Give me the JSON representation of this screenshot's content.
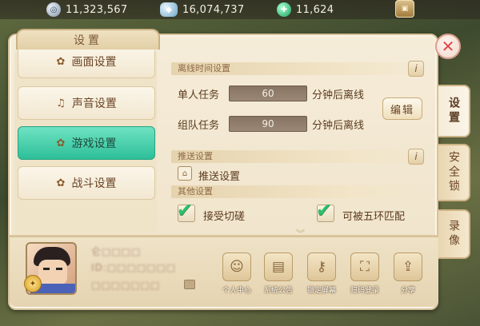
{
  "resources": [
    {
      "icon": "silver-coin-icon",
      "value": "11,323,567"
    },
    {
      "icon": "silver-ingot-icon",
      "value": "16,074,737"
    },
    {
      "icon": "jade-gem-icon",
      "value": "11,624"
    }
  ],
  "panel": {
    "title": "设置"
  },
  "menu": {
    "items": [
      {
        "label": "画面设置",
        "icon": "graphics-icon",
        "active": false
      },
      {
        "label": "声音设置",
        "icon": "music-note-icon",
        "active": false
      },
      {
        "label": "游戏设置",
        "icon": "game-gear-icon",
        "active": true
      },
      {
        "label": "战斗设置",
        "icon": "battle-icon",
        "active": false
      }
    ]
  },
  "offline": {
    "section_title": "离线时间设置",
    "solo": {
      "label": "单人任务",
      "value": "60",
      "suffix": "分钟后离线"
    },
    "team": {
      "label": "组队任务",
      "value": "90",
      "suffix": "分钟后离线"
    },
    "edit_label": "编辑"
  },
  "push": {
    "section_title": "推送设置",
    "item_label": "推送设置"
  },
  "other": {
    "section_title": "其他设置",
    "options": [
      {
        "label": "接受切磋",
        "checked": true
      },
      {
        "label": "可被五环匹配",
        "checked": true
      }
    ]
  },
  "side_tabs": [
    {
      "label": "设置",
      "active": true
    },
    {
      "label": "安全锁",
      "active": false
    },
    {
      "label": "录像",
      "active": false
    }
  ],
  "profile": {
    "name_line1": "仑□□□□",
    "name_line2": "ID:□□□□□□□",
    "name_line3": "□□□□□□□"
  },
  "functions": [
    {
      "label": "个人中心",
      "icon": "person-icon"
    },
    {
      "label": "系统公告",
      "icon": "scroll-icon"
    },
    {
      "label": "锁定屏幕",
      "icon": "key-icon"
    },
    {
      "label": "扫码登录",
      "icon": "scan-icon"
    },
    {
      "label": "分享",
      "icon": "share-icon"
    }
  ],
  "colors": {
    "active_tab": "#2dbf98",
    "checkmark": "#2fbf6a",
    "close_x": "#e04848"
  }
}
